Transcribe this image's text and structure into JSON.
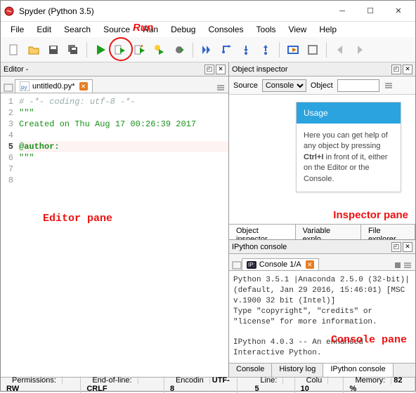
{
  "window": {
    "title": "Spyder (Python 3.5)"
  },
  "menu": [
    "File",
    "Edit",
    "Search",
    "Source",
    "Run",
    "Debug",
    "Consoles",
    "Tools",
    "View",
    "Help"
  ],
  "annotations": {
    "run_label": "Run",
    "editor_pane": "Editor pane",
    "inspector_pane": "Inspector pane",
    "console_pane": "Console pane"
  },
  "editor_pane": {
    "header": "Editor -",
    "tab": {
      "filename": "untitled0.py*"
    },
    "lines": [
      {
        "n": "1",
        "text": "# -*- coding: utf-8 -*-",
        "cls": "c-cm"
      },
      {
        "n": "2",
        "text": "\"\"\"",
        "cls": "c-str"
      },
      {
        "n": "3",
        "text": "Created on Thu Aug 17 00:26:39 2017",
        "cls": "c-str"
      },
      {
        "n": "4",
        "text": "",
        "cls": ""
      },
      {
        "n": "5",
        "text": "@author:",
        "cls": "c-dec",
        "hl": true
      },
      {
        "n": "6",
        "text": "\"\"\"",
        "cls": "c-str"
      },
      {
        "n": "7",
        "text": "",
        "cls": ""
      },
      {
        "n": "8",
        "text": "",
        "cls": ""
      }
    ]
  },
  "inspector": {
    "header": "Object inspector",
    "source_label": "Source",
    "source_value": "Console",
    "object_label": "Object",
    "object_value": "",
    "usage_title": "Usage",
    "usage_body_pre": "Here you can get help of any object by pressing ",
    "usage_key": "Ctrl+I",
    "usage_body_post": " in front of it, either on the Editor or the Console.",
    "tabs": [
      "Object inspector",
      "Variable explo...",
      "File explorer"
    ]
  },
  "ipython": {
    "header": "IPython console",
    "tab_label": "Console 1/A",
    "output": "Python 3.5.1 |Anaconda 2.5.0 (32-bit)| (default, Jan 29 2016, 15:46:01) [MSC v.1900 32 bit (Intel)]\nType \"copyright\", \"credits\" or \"license\" for more information.\n\nIPython 4.0.3 -- An enhanced Interactive Python.",
    "bottom_tabs": [
      "Console",
      "History log",
      "IPython console"
    ]
  },
  "status": {
    "permissions_label": "Permissions:",
    "permissions": "RW",
    "eol_label": "End-of-line:",
    "eol": "CRLF",
    "encoding_label": "Encodin",
    "encoding": "UTF-8",
    "line_label": "Line:",
    "line": "5",
    "col_label": "Colu",
    "col": "10",
    "mem_label": "Memory:",
    "mem": "82 %"
  }
}
